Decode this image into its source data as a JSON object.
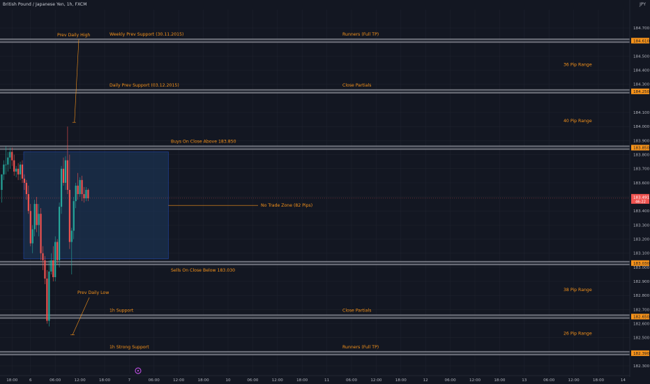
{
  "header": {
    "symbol_title": "British Pound / Japanese Yen, 1h, FXCM",
    "currency": "JPY"
  },
  "colors": {
    "background": "#131722",
    "bull": "#26a69a",
    "bear": "#ef5350",
    "annotation": "#f7931a",
    "zone_band": "#9598a1",
    "box_fill": "#1e3a5f",
    "box_border": "#2962ff",
    "grid": "#1e222d",
    "axis_text": "#b2b5be"
  },
  "chart_data": {
    "type": "candlestick",
    "symbol": "GBPJPY",
    "timeframe": "1h",
    "ylim": [
      182.33,
      184.8
    ],
    "y_ticks": [
      "184.700",
      "184.610",
      "184.500",
      "184.400",
      "184.300",
      "184.250",
      "184.100",
      "184.000",
      "183.900",
      "183.850",
      "183.800",
      "183.700",
      "183.600",
      "183.500",
      "183.491",
      "183.400",
      "183.300",
      "183.200",
      "183.100",
      "183.030",
      "183.000",
      "182.900",
      "182.800",
      "182.700",
      "182.650",
      "182.600",
      "182.500",
      "182.390",
      "182.300"
    ],
    "y_tick_values": [
      184.7,
      184.61,
      184.5,
      184.4,
      184.3,
      184.25,
      184.1,
      184.0,
      183.9,
      183.85,
      183.8,
      183.7,
      183.6,
      183.5,
      183.491,
      183.4,
      183.3,
      183.2,
      183.1,
      183.03,
      183.0,
      182.9,
      182.8,
      182.7,
      182.65,
      182.6,
      182.5,
      182.39,
      182.3
    ],
    "x_ticks": [
      "18:00",
      "6",
      "06:00",
      "12:00",
      "18:00",
      "7",
      "06:00",
      "12:00",
      "18:00",
      "10",
      "06:00",
      "12:00",
      "18:00",
      "11",
      "06:00",
      "12:00",
      "18:00",
      "12",
      "06:00",
      "12:00",
      "18:00",
      "13",
      "06:00",
      "12:00",
      "18:00",
      "14"
    ],
    "x_tick_bars": [
      5,
      14,
      26,
      38,
      50,
      62,
      74,
      86,
      98,
      110,
      122,
      134,
      146,
      158,
      170,
      182,
      194,
      206,
      218,
      230,
      242,
      254,
      266,
      278,
      290,
      302
    ],
    "x_bar_range": [
      0,
      306
    ],
    "candles": [
      {
        "i": 0,
        "o": 183.55,
        "h": 183.66,
        "l": 183.46,
        "c": 183.66
      },
      {
        "i": 1,
        "o": 183.66,
        "h": 183.76,
        "l": 183.62,
        "c": 183.73
      },
      {
        "i": 2,
        "o": 183.73,
        "h": 183.86,
        "l": 183.66,
        "c": 183.73
      },
      {
        "i": 3,
        "o": 183.73,
        "h": 183.82,
        "l": 183.68,
        "c": 183.78
      },
      {
        "i": 4,
        "o": 183.78,
        "h": 183.85,
        "l": 183.7,
        "c": 183.82
      },
      {
        "i": 5,
        "o": 183.82,
        "h": 183.85,
        "l": 183.72,
        "c": 183.76
      },
      {
        "i": 6,
        "o": 183.76,
        "h": 183.8,
        "l": 183.65,
        "c": 183.68
      },
      {
        "i": 7,
        "o": 183.68,
        "h": 183.72,
        "l": 183.64,
        "c": 183.7
      },
      {
        "i": 8,
        "o": 183.7,
        "h": 183.74,
        "l": 183.62,
        "c": 183.66
      },
      {
        "i": 9,
        "o": 183.66,
        "h": 183.75,
        "l": 183.62,
        "c": 183.73
      },
      {
        "i": 10,
        "o": 183.73,
        "h": 183.76,
        "l": 183.6,
        "c": 183.63
      },
      {
        "i": 11,
        "o": 183.63,
        "h": 183.66,
        "l": 183.55,
        "c": 183.6
      },
      {
        "i": 12,
        "o": 183.6,
        "h": 183.62,
        "l": 183.48,
        "c": 183.52
      },
      {
        "i": 13,
        "o": 183.52,
        "h": 183.58,
        "l": 183.38,
        "c": 183.4
      },
      {
        "i": 14,
        "o": 183.4,
        "h": 183.45,
        "l": 183.15,
        "c": 183.17
      },
      {
        "i": 15,
        "o": 183.17,
        "h": 183.3,
        "l": 183.1,
        "c": 183.27
      },
      {
        "i": 16,
        "o": 183.27,
        "h": 183.48,
        "l": 183.22,
        "c": 183.45
      },
      {
        "i": 17,
        "o": 183.45,
        "h": 183.5,
        "l": 183.25,
        "c": 183.3
      },
      {
        "i": 18,
        "o": 183.3,
        "h": 183.45,
        "l": 183.22,
        "c": 183.38
      },
      {
        "i": 19,
        "o": 183.38,
        "h": 183.42,
        "l": 183.05,
        "c": 183.1
      },
      {
        "i": 20,
        "o": 183.1,
        "h": 183.15,
        "l": 182.98,
        "c": 183.05
      },
      {
        "i": 21,
        "o": 183.05,
        "h": 183.08,
        "l": 182.88,
        "c": 182.92
      },
      {
        "i": 22,
        "o": 182.92,
        "h": 182.98,
        "l": 182.6,
        "c": 182.62
      },
      {
        "i": 23,
        "o": 182.62,
        "h": 183.05,
        "l": 182.58,
        "c": 182.97
      },
      {
        "i": 24,
        "o": 182.97,
        "h": 183.1,
        "l": 182.95,
        "c": 183.05
      },
      {
        "i": 25,
        "o": 183.05,
        "h": 183.15,
        "l": 182.9,
        "c": 182.93
      },
      {
        "i": 26,
        "o": 182.93,
        "h": 183.22,
        "l": 182.9,
        "c": 183.18
      },
      {
        "i": 27,
        "o": 183.18,
        "h": 183.2,
        "l": 183.02,
        "c": 183.05
      },
      {
        "i": 28,
        "o": 183.05,
        "h": 183.46,
        "l": 183.0,
        "c": 183.43
      },
      {
        "i": 29,
        "o": 183.43,
        "h": 183.72,
        "l": 183.38,
        "c": 183.7
      },
      {
        "i": 30,
        "o": 183.7,
        "h": 183.78,
        "l": 183.58,
        "c": 183.6
      },
      {
        "i": 31,
        "o": 183.6,
        "h": 183.79,
        "l": 183.55,
        "c": 183.76
      },
      {
        "i": 32,
        "o": 183.76,
        "h": 184.0,
        "l": 183.52,
        "c": 183.55
      },
      {
        "i": 33,
        "o": 183.55,
        "h": 183.8,
        "l": 183.13,
        "c": 183.18
      },
      {
        "i": 34,
        "o": 183.18,
        "h": 183.28,
        "l": 182.95,
        "c": 183.26
      },
      {
        "i": 35,
        "o": 183.26,
        "h": 183.5,
        "l": 183.2,
        "c": 183.47
      },
      {
        "i": 36,
        "o": 183.47,
        "h": 183.6,
        "l": 183.42,
        "c": 183.58
      },
      {
        "i": 37,
        "o": 183.58,
        "h": 183.67,
        "l": 183.48,
        "c": 183.52
      },
      {
        "i": 38,
        "o": 183.52,
        "h": 183.64,
        "l": 183.5,
        "c": 183.62
      },
      {
        "i": 39,
        "o": 183.62,
        "h": 183.65,
        "l": 183.47,
        "c": 183.52
      },
      {
        "i": 40,
        "o": 183.52,
        "h": 183.57,
        "l": 183.46,
        "c": 183.49
      },
      {
        "i": 41,
        "o": 183.49,
        "h": 183.57,
        "l": 183.47,
        "c": 183.55
      },
      {
        "i": 42,
        "o": 183.55,
        "h": 183.56,
        "l": 183.47,
        "c": 183.49
      }
    ],
    "current_price": {
      "value": 183.491,
      "label": "183.491",
      "countdown": "46:22"
    },
    "levels": [
      {
        "price": 184.61,
        "label": "184.610",
        "left_text": "Weekly Prev Support (30.11.2015)",
        "right_text": "Runners (Full TP)"
      },
      {
        "price": 184.25,
        "label": "184.250",
        "left_text": "Daily Prev Support (03.12.2015)",
        "right_text": "Close Partials"
      },
      {
        "price": 183.85,
        "label": "183.850",
        "left_text": "Buys On Close Above 183.850",
        "right_text": ""
      },
      {
        "price": 183.03,
        "label": "183.030",
        "left_text": "Sells On Close Below 183.030",
        "right_text": ""
      },
      {
        "price": 182.65,
        "label": "182.650",
        "left_text": "1h Support",
        "right_text": "Close Partials"
      },
      {
        "price": 182.39,
        "label": "182.390",
        "left_text": "1h Strong Support",
        "right_text": "Runners (Full TP)"
      }
    ],
    "range_labels": [
      {
        "text": "36 Pip Range",
        "price": 184.44
      },
      {
        "text": "40 Pip Range",
        "price": 184.04
      },
      {
        "text": "38 Pip Range",
        "price": 182.84
      },
      {
        "text": "26 Pip Range",
        "price": 182.53
      }
    ],
    "zone_box": {
      "bar_from": 11,
      "bar_to": 81,
      "price_from": 183.06,
      "price_to": 183.82
    },
    "zone_label": "No Trade Zone (82 Pips)",
    "annotations": [
      {
        "text": "Prev Daily High",
        "price": 184.65,
        "bar": 35
      },
      {
        "text": "Prev Daily Low",
        "price": 182.82,
        "bar": 44
      }
    ]
  }
}
